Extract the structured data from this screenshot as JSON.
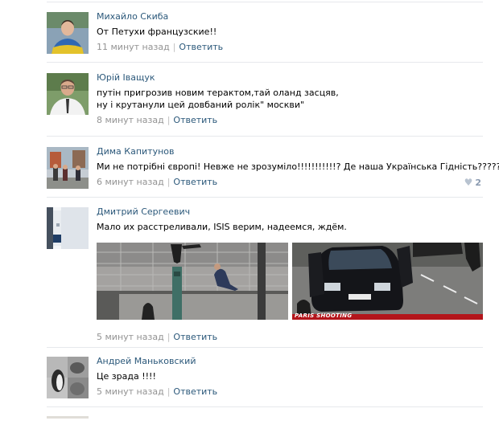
{
  "comments": [
    {
      "author": "Михайло Скиба",
      "text_lines": [
        "От Петухи французские!!"
      ],
      "time": "11 минут назад",
      "reply": "Ответить"
    },
    {
      "author": "Юрій Іващук",
      "text_lines": [
        "путін пригрозив новим терактом,тай оланд засцяв,",
        "ну і крутанули цей довбаний ролік\" москви\""
      ],
      "time": "8 минут назад",
      "reply": "Ответить"
    },
    {
      "author": "Дима Капитунов",
      "text_lines": [
        "Ми не потрібні європі! Невже не зрозуміло!!!!!!!!!!!? Де наша Українська Гідність??????"
      ],
      "time": "6 минут назад",
      "reply": "Ответить",
      "likes": "2"
    },
    {
      "author": "Дмитрий Сергеевич",
      "text_lines": [
        "Мало их расстреливали, ISIS верим, надеемся, ждём."
      ],
      "time": "5 минут назад",
      "reply": "Ответить",
      "photo_caption": "PARIS SHOOTING"
    },
    {
      "author": "Андрей Маньковский",
      "text_lines": [
        "Це зрада !!!!"
      ],
      "time": "5 минут назад",
      "reply": "Ответить"
    }
  ],
  "icons": {
    "like": "heart-icon"
  },
  "colors": {
    "link": "#2b587a",
    "meta": "#939393",
    "divider": "#e6e8ec",
    "news_bar": "#b3151b"
  }
}
